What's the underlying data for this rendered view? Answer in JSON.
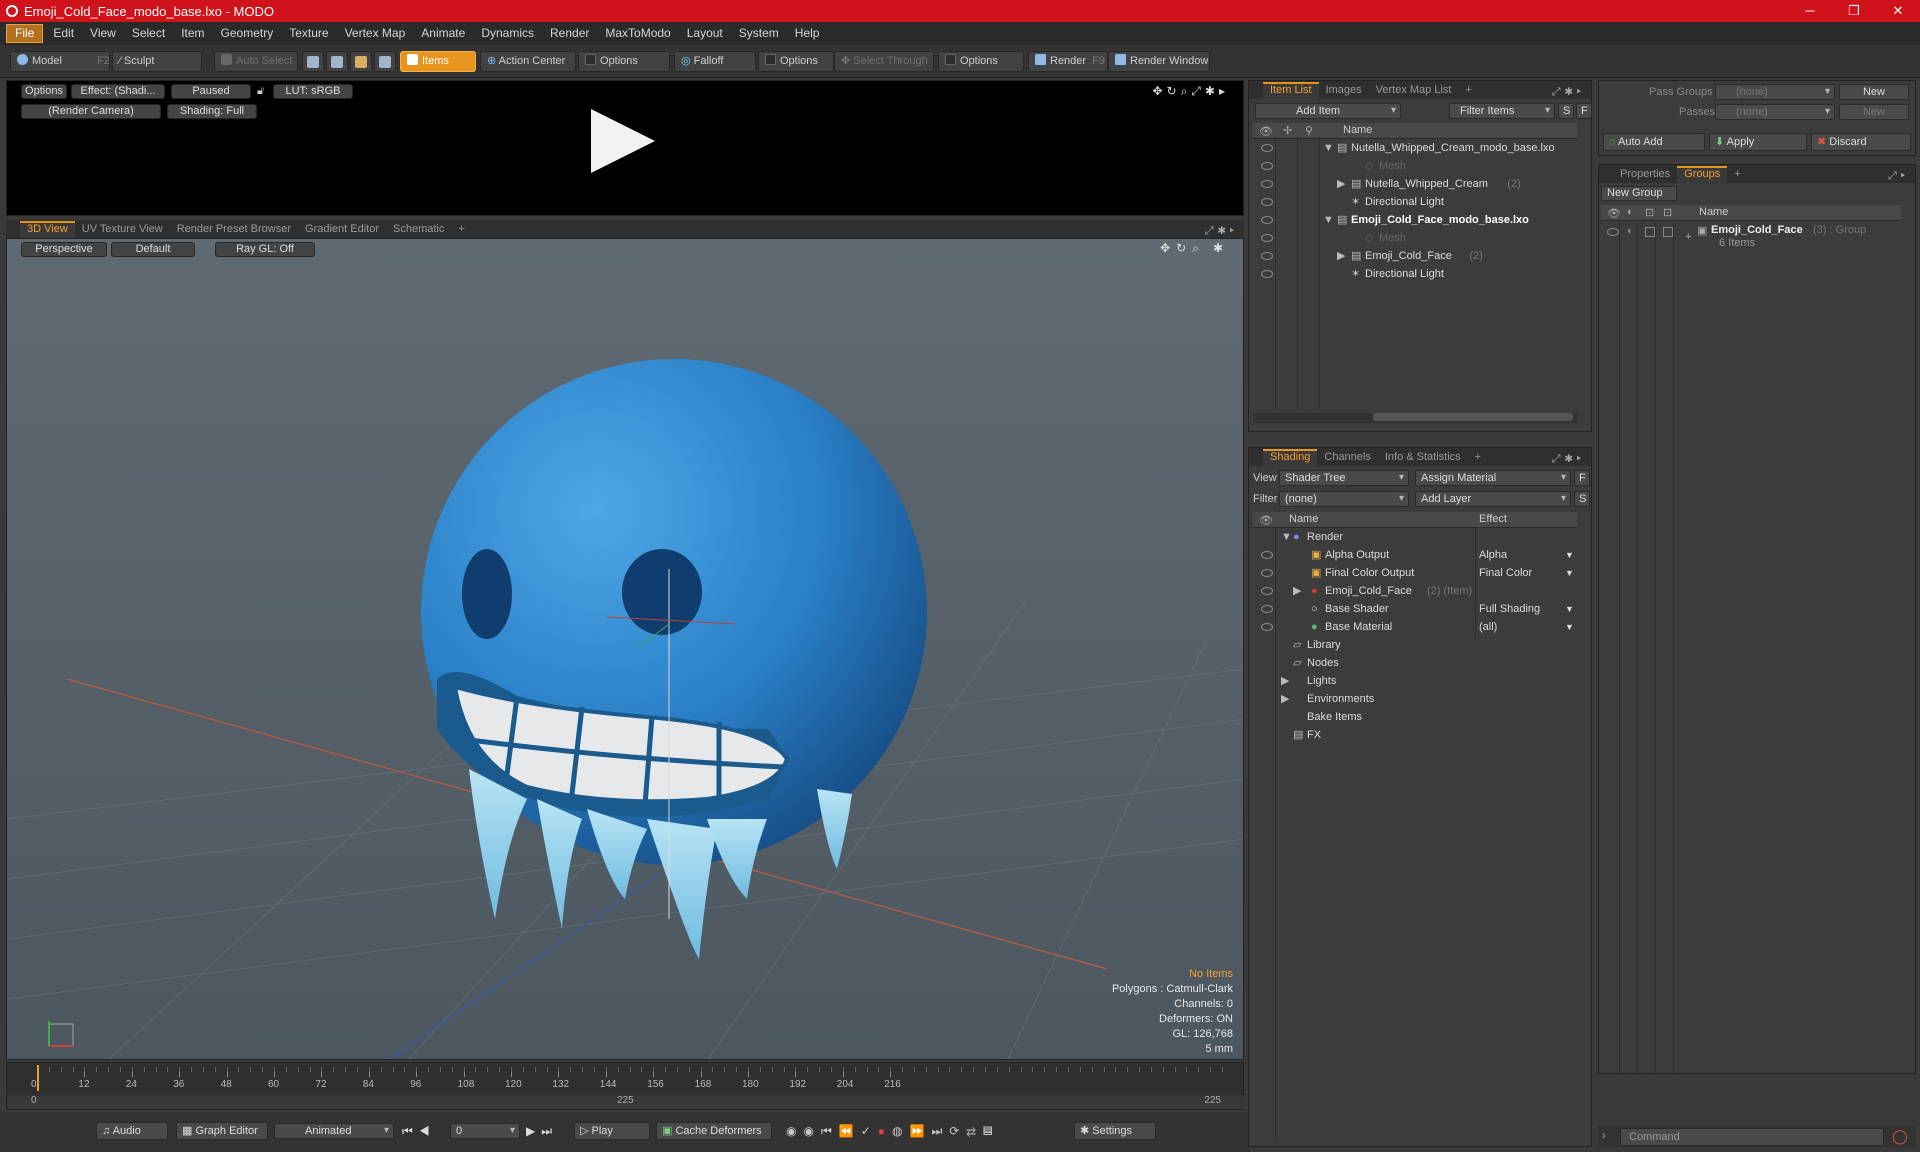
{
  "window": {
    "title": "Emoji_Cold_Face_modo_base.lxo - MODO",
    "minimize": "─",
    "restore": "❐",
    "close": "✕"
  },
  "menu": [
    "File",
    "Edit",
    "View",
    "Select",
    "Item",
    "Geometry",
    "Texture",
    "Vertex Map",
    "Animate",
    "Dynamics",
    "Render",
    "MaxToModo",
    "Layout",
    "System",
    "Help"
  ],
  "toolbar": {
    "model": "Model",
    "model_key": "F2",
    "sculpt": "Sculpt",
    "auto_select": "Auto Select",
    "items": "Items",
    "action_center": "Action Center",
    "options1": "Options",
    "falloff": "Falloff",
    "options2": "Options",
    "select_through": "Select Through",
    "options3": "Options",
    "render": "Render",
    "render_key": "F9",
    "render_window": "Render Window"
  },
  "preview": {
    "options": "Options",
    "effect": "Effect: (Shadi...",
    "paused": "Paused",
    "lut": "LUT: sRGB",
    "camera": "(Render Camera)",
    "shading": "Shading: Full"
  },
  "viewport_tabs": [
    "3D View",
    "UV Texture View",
    "Render Preset Browser",
    "Gradient Editor",
    "Schematic"
  ],
  "viewport": {
    "perspective": "Perspective",
    "default": "Default",
    "raygl": "Ray GL: Off"
  },
  "stats": {
    "no_items": "No Items",
    "polygons": "Polygons : Catmull-Clark",
    "channels": "Channels: 0",
    "deformers": "Deformers: ON",
    "gl": "GL: 126,768",
    "size": "5 mm"
  },
  "timeline": {
    "ticks": [
      "0",
      "12",
      "24",
      "36",
      "48",
      "60",
      "72",
      "84",
      "96",
      "108",
      "120",
      "132",
      "144",
      "156",
      "168",
      "180",
      "192",
      "204",
      "216"
    ],
    "start": "0",
    "mid": "225",
    "end": "225"
  },
  "bottom": {
    "audio": "Audio",
    "graph_editor": "Graph Editor",
    "animated": "Animated",
    "frame": "0",
    "play": "Play",
    "cache": "Cache Deformers",
    "settings": "Settings"
  },
  "itemlist": {
    "tabs": [
      "Item List",
      "Images",
      "Vertex Map List"
    ],
    "add_item": "Add Item",
    "filter": "Filter Items",
    "s": "S",
    "f": "F",
    "col_name": "Name",
    "rows": [
      {
        "label": "Nutella_Whipped_Cream_modo_base.lxo",
        "extra": "",
        "indent": 0,
        "arrow": "▼",
        "bold": false,
        "dim": false
      },
      {
        "label": "Mesh",
        "extra": "",
        "indent": 2,
        "arrow": "",
        "bold": false,
        "dim": true
      },
      {
        "label": "Nutella_Whipped_Cream",
        "extra": "(2)",
        "indent": 1,
        "arrow": "▶",
        "bold": false,
        "dim": false
      },
      {
        "label": "Directional Light",
        "extra": "",
        "indent": 1,
        "arrow": "",
        "bold": false,
        "dim": false
      },
      {
        "label": "Emoji_Cold_Face_modo_base.lxo",
        "extra": "",
        "indent": 0,
        "arrow": "▼",
        "bold": true,
        "dim": false
      },
      {
        "label": "Mesh",
        "extra": "",
        "indent": 2,
        "arrow": "",
        "bold": false,
        "dim": true
      },
      {
        "label": "Emoji_Cold_Face",
        "extra": "(2)",
        "indent": 1,
        "arrow": "▶",
        "bold": false,
        "dim": false
      },
      {
        "label": "Directional Light",
        "extra": "",
        "indent": 1,
        "arrow": "",
        "bold": false,
        "dim": false
      }
    ]
  },
  "shading": {
    "tabs": [
      "Shading",
      "Channels",
      "Info & Statistics"
    ],
    "view_label": "View",
    "view_value": "Shader Tree",
    "assign": "Assign Material",
    "filter_label": "Filter",
    "filter_value": "(none)",
    "add_layer": "Add Layer",
    "f": "F",
    "s": "S",
    "col_name": "Name",
    "col_effect": "Effect",
    "rows": [
      {
        "label": "Render",
        "extra": "",
        "effect": "",
        "indent": 0
      },
      {
        "label": "Alpha Output",
        "extra": "",
        "effect": "Alpha",
        "indent": 1
      },
      {
        "label": "Final Color Output",
        "extra": "",
        "effect": "Final Color",
        "indent": 1
      },
      {
        "label": "Emoji_Cold_Face",
        "extra": "(2) (Item)",
        "effect": "",
        "indent": 1
      },
      {
        "label": "Base Shader",
        "extra": "",
        "effect": "Full Shading",
        "indent": 1
      },
      {
        "label": "Base Material",
        "extra": "",
        "effect": "(all)",
        "indent": 1
      },
      {
        "label": "Library",
        "extra": "",
        "effect": "",
        "indent": 0
      },
      {
        "label": "Nodes",
        "extra": "",
        "effect": "",
        "indent": 0
      },
      {
        "label": "Lights",
        "extra": "",
        "effect": "",
        "indent": 0
      },
      {
        "label": "Environments",
        "extra": "",
        "effect": "",
        "indent": 0
      },
      {
        "label": "Bake Items",
        "extra": "",
        "effect": "",
        "indent": 0
      },
      {
        "label": "FX",
        "extra": "",
        "effect": "",
        "indent": 0
      }
    ]
  },
  "passes": {
    "pass_groups": "Pass Groups",
    "passes": "Passes",
    "none1": "(none)",
    "none2": "(none)",
    "new1": "New",
    "new2": "New",
    "auto_add": "Auto Add",
    "apply": "Apply",
    "discard": "Discard"
  },
  "groups": {
    "tabs": [
      "Properties",
      "Groups"
    ],
    "new_group": "New Group",
    "col_name": "Name",
    "item": "Emoji_Cold_Face",
    "item_count": "(3) : Group",
    "item_sub": "6 Items"
  },
  "command": {
    "placeholder": "Command"
  },
  "colors": {
    "accent": "#e8951f",
    "titlebar": "#d0121b",
    "face": "#2f86cf"
  }
}
